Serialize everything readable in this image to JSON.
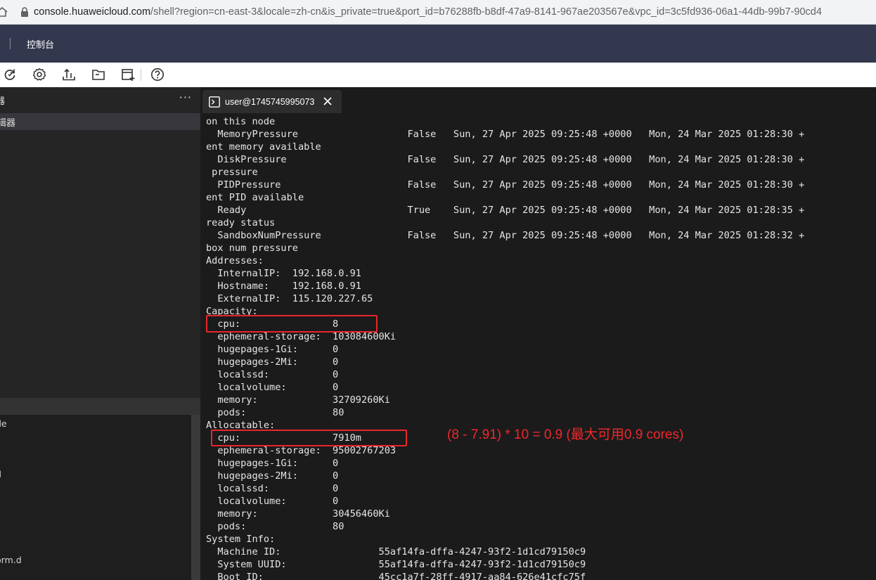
{
  "browser": {
    "url_host": "console.huaweicloud.com",
    "url_rest": "/shell?region=cn-east-3&locale=zh-cn&is_private=true&port_id=b76288fb-b8df-47a9-8141-967ae203567e&vpc_id=3c5fd936-06a1-44db-99b7-90cd4"
  },
  "navbar": {
    "title": "控制台"
  },
  "toolbar": {
    "icons": [
      "refresh-icon",
      "settings-icon",
      "upload-icon",
      "folder-icon",
      "new-window-icon",
      "help-icon"
    ]
  },
  "sidebar": {
    "header_label": "器",
    "header_more": "···",
    "selected_label": "辑器",
    "items": [
      "de",
      "",
      "d",
      "orm.d"
    ]
  },
  "terminal": {
    "tab_label": "user@1745745995073",
    "lines": [
      "on this node",
      "  MemoryPressure                   False   Sun, 27 Apr 2025 09:25:48 +0000   Mon, 24 Mar 2025 01:28:30 +",
      "ent memory available",
      "  DiskPressure                     False   Sun, 27 Apr 2025 09:25:48 +0000   Mon, 24 Mar 2025 01:28:30 +",
      " pressure",
      "  PIDPressure                      False   Sun, 27 Apr 2025 09:25:48 +0000   Mon, 24 Mar 2025 01:28:30 +",
      "ent PID available",
      "  Ready                            True    Sun, 27 Apr 2025 09:25:48 +0000   Mon, 24 Mar 2025 01:28:35 +",
      "ready status",
      "  SandboxNumPressure               False   Sun, 27 Apr 2025 09:25:48 +0000   Mon, 24 Mar 2025 01:28:32 +",
      "box num pressure",
      "Addresses:",
      "  InternalIP:  192.168.0.91",
      "  Hostname:    192.168.0.91",
      "  ExternalIP:  115.120.227.65",
      "Capacity:",
      "  cpu:                8",
      "  ephemeral-storage:  103084600Ki",
      "  hugepages-1Gi:      0",
      "  hugepages-2Mi:      0",
      "  localssd:           0",
      "  localvolume:        0",
      "  memory:             32709260Ki",
      "  pods:               80",
      "Allocatable:",
      "  cpu:                7910m",
      "  ephemeral-storage:  95002767203",
      "  hugepages-1Gi:      0",
      "  hugepages-2Mi:      0",
      "  localssd:           0",
      "  localvolume:        0",
      "  memory:             30456460Ki",
      "  pods:               80",
      "System Info:",
      "  Machine ID:                 55af14fa-dffa-4247-93f2-1d1cd79150c9",
      "  System UUID:                55af14fa-dffa-4247-93f2-1d1cd79150c9",
      "  Boot ID:                    45cc1a7f-28ff-4917-aa84-626e41cfc75f"
    ]
  },
  "annotation": {
    "text": "(8 - 7.91) * 10 = 0.9 (最大可用0.9 cores)",
    "color": "#f0272c"
  }
}
